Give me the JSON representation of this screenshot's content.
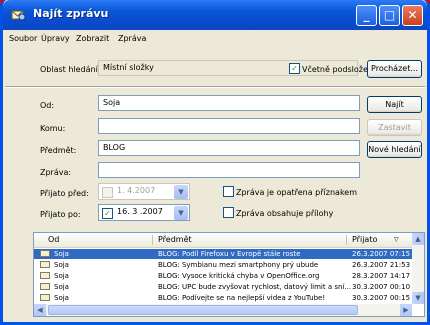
{
  "window": {
    "title": "Najít zprávu"
  },
  "titlebar_buttons": {
    "minimize": "_",
    "maximize": "□",
    "close": "✕"
  },
  "menu": [
    "Soubor",
    "Úpravy",
    "Zobrazit",
    "Zpráva"
  ],
  "scope": {
    "label": "Oblast hledání:",
    "value": "Místní složky",
    "include_subfolders_label": "Včetně podsložek",
    "include_subfolders_checked": true,
    "browse_label": "Procházet..."
  },
  "fields": {
    "od_label": "Od:",
    "od_value": "Soja",
    "komu_label": "Komu:",
    "komu_value": "",
    "predmet_label": "Předmět:",
    "predmet_value": "BLOG",
    "zprava_label": "Zpráva:",
    "zprava_value": ""
  },
  "buttons": {
    "find": "Najít",
    "stop": "Zastavit",
    "new_search": "Nové hledání"
  },
  "dates": {
    "before_label": "Přijato před:",
    "before_value": "1. 4.2007",
    "before_checked": false,
    "after_label": "Přijato po:",
    "after_value": "16. 3 .2007",
    "after_checked": true,
    "combo_arrow": "▼"
  },
  "options": {
    "flagged_label": "Zpráva je opatřena příznakem",
    "attachments_label": "Zpráva obsahuje přílohy"
  },
  "results": {
    "columns": [
      "Od",
      "Předmět",
      "Přijato"
    ],
    "sort_glyph": "▽",
    "rows": [
      {
        "from": "Soja",
        "subject": "BLOG: Podíl Firefoxu v Evropě stále roste",
        "received": "26.3.2007 07:15",
        "selected": true
      },
      {
        "from": "Soja",
        "subject": "BLOG: Symbianu mezi smartphony prý ubude",
        "received": "26.3.2007 21:53",
        "selected": false
      },
      {
        "from": "Soja",
        "subject": "BLOG: Vysoce kritická chyba v OpenOffice.org",
        "received": "28.3.2007 14:17",
        "selected": false
      },
      {
        "from": "Soja",
        "subject": "BLOG: UPC bude zvyšovat rychlost, datový limit a sní...",
        "received": "30.3.2007 00:10",
        "selected": false
      },
      {
        "from": "Soja",
        "subject": "BLOG: Podívejte se na nejlepší videa z YouTube!",
        "received": "30.3.2007 00:15",
        "selected": false
      }
    ],
    "scroll_up": "▲",
    "scroll_down": "▼",
    "scroll_left": "◀",
    "scroll_right": "▶"
  }
}
